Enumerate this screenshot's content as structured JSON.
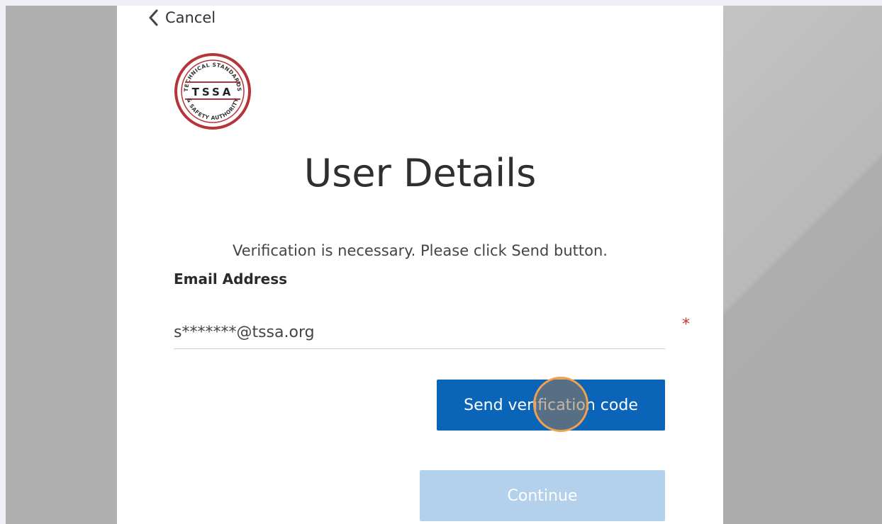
{
  "nav": {
    "cancel_label": "Cancel"
  },
  "logo": {
    "top_text": "TECHNICAL STANDARDS",
    "center_text": "TSSA",
    "bottom_text": "& SAFETY AUTHORITY",
    "ring_color": "#b5343a"
  },
  "page": {
    "title": "User Details",
    "intro": "Verification is necessary. Please click Send button."
  },
  "form": {
    "email_label": "Email Address",
    "email_value": "s*******@tssa.org",
    "required_mark": "*",
    "send_button_label": "Send verification code",
    "continue_button_label": "Continue"
  },
  "colors": {
    "primary": "#0a65b8",
    "disabled": "#b3d1ea",
    "required": "#c0392b",
    "click_indicator": "#f0a050"
  }
}
